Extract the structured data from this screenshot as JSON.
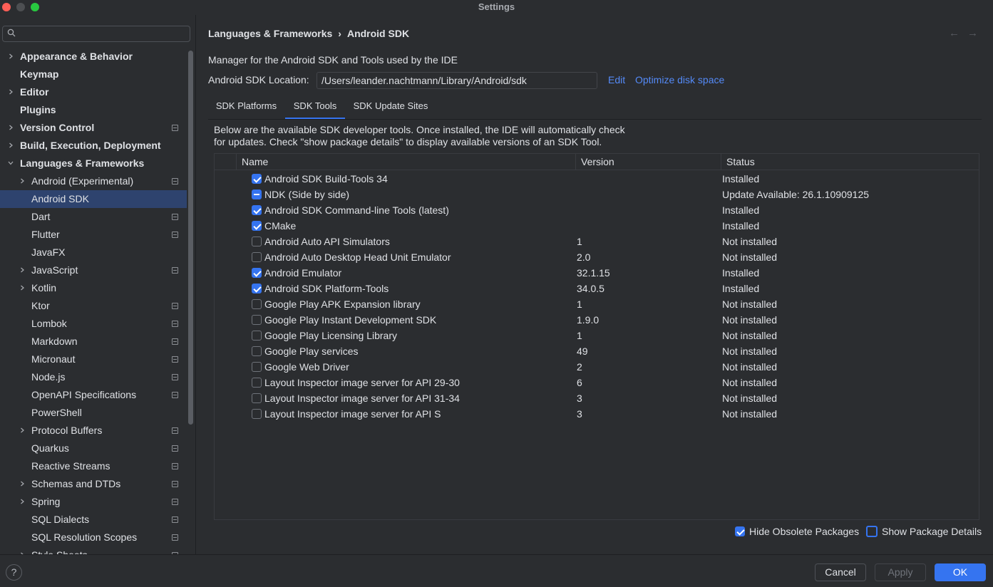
{
  "window": {
    "title": "Settings"
  },
  "search": {
    "placeholder": "",
    "value": ""
  },
  "sidebar": {
    "items": [
      {
        "label": "Appearance & Behavior",
        "bold": true,
        "expanded": false,
        "chevron": true,
        "level": 0,
        "project": false
      },
      {
        "label": "Keymap",
        "bold": true,
        "chevron": false,
        "level": 0,
        "project": false
      },
      {
        "label": "Editor",
        "bold": true,
        "chevron": true,
        "expanded": false,
        "level": 0,
        "project": false
      },
      {
        "label": "Plugins",
        "bold": true,
        "chevron": false,
        "level": 0,
        "project": false
      },
      {
        "label": "Version Control",
        "bold": true,
        "chevron": true,
        "expanded": false,
        "level": 0,
        "project": true
      },
      {
        "label": "Build, Execution, Deployment",
        "bold": true,
        "chevron": true,
        "expanded": false,
        "level": 0,
        "project": false
      },
      {
        "label": "Languages & Frameworks",
        "bold": true,
        "chevron": true,
        "expanded": true,
        "level": 0,
        "project": false
      },
      {
        "label": "Android (Experimental)",
        "bold": false,
        "chevron": true,
        "expanded": false,
        "level": 1,
        "project": true
      },
      {
        "label": "Android SDK",
        "bold": false,
        "chevron": false,
        "level": 1,
        "project": false,
        "selected": true
      },
      {
        "label": "Dart",
        "bold": false,
        "chevron": false,
        "level": 1,
        "project": true
      },
      {
        "label": "Flutter",
        "bold": false,
        "chevron": false,
        "level": 1,
        "project": true
      },
      {
        "label": "JavaFX",
        "bold": false,
        "chevron": false,
        "level": 1,
        "project": false
      },
      {
        "label": "JavaScript",
        "bold": false,
        "chevron": true,
        "expanded": false,
        "level": 1,
        "project": true
      },
      {
        "label": "Kotlin",
        "bold": false,
        "chevron": true,
        "expanded": false,
        "level": 1,
        "project": false
      },
      {
        "label": "Ktor",
        "bold": false,
        "chevron": false,
        "level": 1,
        "project": true
      },
      {
        "label": "Lombok",
        "bold": false,
        "chevron": false,
        "level": 1,
        "project": true
      },
      {
        "label": "Markdown",
        "bold": false,
        "chevron": false,
        "level": 1,
        "project": true
      },
      {
        "label": "Micronaut",
        "bold": false,
        "chevron": false,
        "level": 1,
        "project": true
      },
      {
        "label": "Node.js",
        "bold": false,
        "chevron": false,
        "level": 1,
        "project": true
      },
      {
        "label": "OpenAPI Specifications",
        "bold": false,
        "chevron": false,
        "level": 1,
        "project": true
      },
      {
        "label": "PowerShell",
        "bold": false,
        "chevron": false,
        "level": 1,
        "project": false
      },
      {
        "label": "Protocol Buffers",
        "bold": false,
        "chevron": true,
        "expanded": false,
        "level": 1,
        "project": true
      },
      {
        "label": "Quarkus",
        "bold": false,
        "chevron": false,
        "level": 1,
        "project": true
      },
      {
        "label": "Reactive Streams",
        "bold": false,
        "chevron": false,
        "level": 1,
        "project": true
      },
      {
        "label": "Schemas and DTDs",
        "bold": false,
        "chevron": true,
        "expanded": false,
        "level": 1,
        "project": true
      },
      {
        "label": "Spring",
        "bold": false,
        "chevron": true,
        "expanded": false,
        "level": 1,
        "project": true
      },
      {
        "label": "SQL Dialects",
        "bold": false,
        "chevron": false,
        "level": 1,
        "project": true
      },
      {
        "label": "SQL Resolution Scopes",
        "bold": false,
        "chevron": false,
        "level": 1,
        "project": true
      },
      {
        "label": "Style Sheets",
        "bold": false,
        "chevron": true,
        "expanded": false,
        "level": 1,
        "project": true
      }
    ]
  },
  "main": {
    "breadcrumb": [
      "Languages & Frameworks",
      "Android SDK"
    ],
    "breadcrumb_sep": "›",
    "description": "Manager for the Android SDK and Tools used by the IDE",
    "location_label": "Android SDK Location:",
    "location_value": "/Users/leander.nachtmann/Library/Android/sdk",
    "edit_link": "Edit",
    "optimize_link": "Optimize disk space",
    "tabs": [
      {
        "label": "SDK Platforms",
        "active": false
      },
      {
        "label": "SDK Tools",
        "active": true
      },
      {
        "label": "SDK Update Sites",
        "active": false
      }
    ],
    "help_text_line1": "Below are the available SDK developer tools. Once installed, the IDE will automatically check",
    "help_text_line2": "for updates. Check \"show package details\" to display available versions of an SDK Tool.",
    "table": {
      "headers": {
        "name": "Name",
        "version": "Version",
        "status": "Status"
      },
      "rows": [
        {
          "name": "Android SDK Build-Tools 34",
          "version": "",
          "status": "Installed",
          "state": "checked"
        },
        {
          "name": "NDK (Side by side)",
          "version": "",
          "status": "Update Available: 26.1.10909125",
          "state": "partial"
        },
        {
          "name": "Android SDK Command-line Tools (latest)",
          "version": "",
          "status": "Installed",
          "state": "checked"
        },
        {
          "name": "CMake",
          "version": "",
          "status": "Installed",
          "state": "checked"
        },
        {
          "name": "Android Auto API Simulators",
          "version": "1",
          "status": "Not installed",
          "state": "unchecked"
        },
        {
          "name": "Android Auto Desktop Head Unit Emulator",
          "version": "2.0",
          "status": "Not installed",
          "state": "unchecked"
        },
        {
          "name": "Android Emulator",
          "version": "32.1.15",
          "status": "Installed",
          "state": "checked"
        },
        {
          "name": "Android SDK Platform-Tools",
          "version": "34.0.5",
          "status": "Installed",
          "state": "checked"
        },
        {
          "name": "Google Play APK Expansion library",
          "version": "1",
          "status": "Not installed",
          "state": "unchecked"
        },
        {
          "name": "Google Play Instant Development SDK",
          "version": "1.9.0",
          "status": "Not installed",
          "state": "unchecked"
        },
        {
          "name": "Google Play Licensing Library",
          "version": "1",
          "status": "Not installed",
          "state": "unchecked"
        },
        {
          "name": "Google Play services",
          "version": "49",
          "status": "Not installed",
          "state": "unchecked"
        },
        {
          "name": "Google Web Driver",
          "version": "2",
          "status": "Not installed",
          "state": "unchecked"
        },
        {
          "name": "Layout Inspector image server for API 29-30",
          "version": "6",
          "status": "Not installed",
          "state": "unchecked"
        },
        {
          "name": "Layout Inspector image server for API 31-34",
          "version": "3",
          "status": "Not installed",
          "state": "unchecked"
        },
        {
          "name": "Layout Inspector image server for API S",
          "version": "3",
          "status": "Not installed",
          "state": "unchecked"
        }
      ]
    },
    "hide_obsolete": {
      "label": "Hide Obsolete Packages",
      "checked": true
    },
    "show_details": {
      "label": "Show Package Details",
      "checked": false
    }
  },
  "footer": {
    "help": "?",
    "cancel": "Cancel",
    "apply": "Apply",
    "ok": "OK"
  },
  "colors": {
    "background": "#2b2d30",
    "accent": "#3574f0",
    "selection": "#2e436e",
    "link": "#548af7",
    "text": "#dfe1e5"
  }
}
